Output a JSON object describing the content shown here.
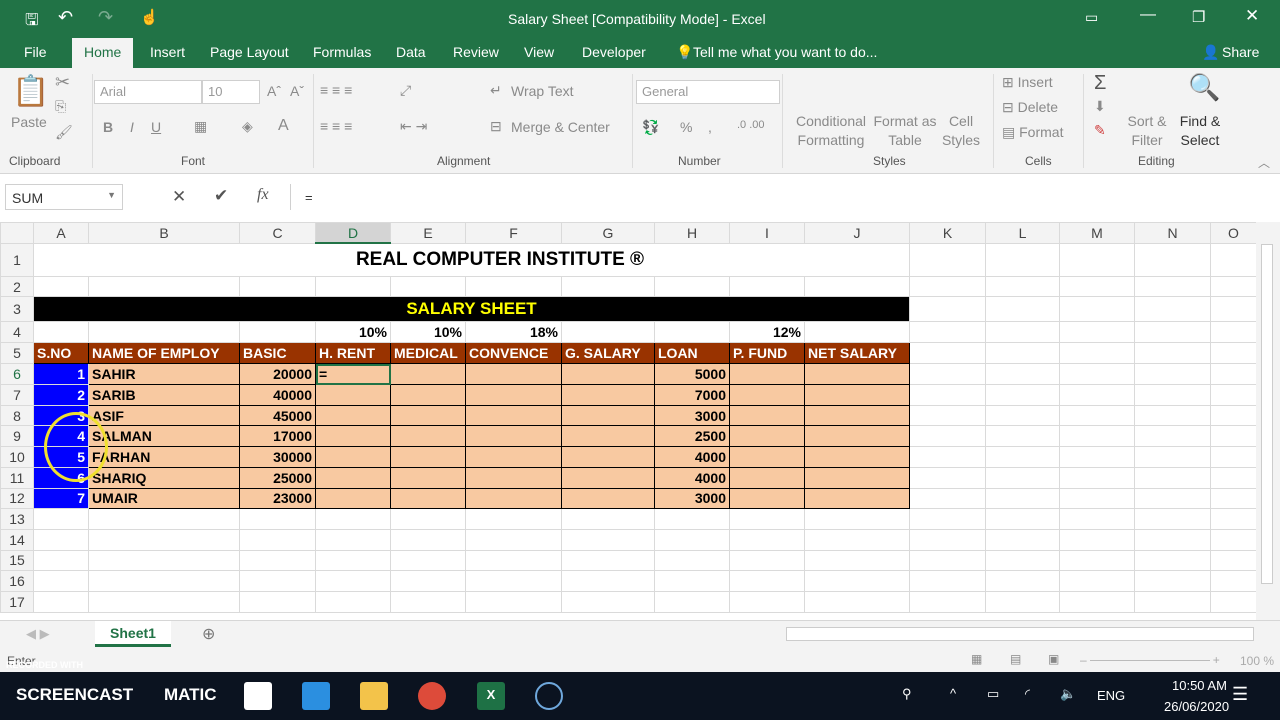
{
  "title": "Salary Sheet  [Compatibility Mode] - Excel",
  "tabs": [
    "File",
    "Home",
    "Insert",
    "Page Layout",
    "Formulas",
    "Data",
    "Review",
    "View",
    "Developer"
  ],
  "tell_me": "Tell me what you want to do...",
  "share": "Share",
  "ribbon": {
    "paste": "Paste",
    "font_name": "Arial",
    "font_size": "10",
    "wrap_text": "Wrap Text",
    "merge_center": "Merge & Center",
    "number_format": "General",
    "conditional": "Conditional Formatting",
    "format_table": "Format as Table",
    "cell_styles": "Cell Styles",
    "insert": "Insert",
    "delete": "Delete",
    "format": "Format",
    "sort": "Sort & Filter",
    "find": "Find & Select",
    "groups": [
      "Clipboard",
      "Font",
      "Alignment",
      "Number",
      "Styles",
      "Cells",
      "Editing"
    ]
  },
  "formula_bar": {
    "name_box": "SUM",
    "formula": "="
  },
  "columns": [
    "A",
    "B",
    "C",
    "D",
    "E",
    "F",
    "G",
    "H",
    "I",
    "J",
    "K",
    "L",
    "M",
    "N",
    "O"
  ],
  "sheet": {
    "title": "REAL COMPUTER INSTITUTE ®",
    "banner": "SALARY SHEET",
    "rates": {
      "D": "10%",
      "E": "10%",
      "F": "18%",
      "I": "12%"
    },
    "headers": [
      "S.NO",
      "NAME OF EMPLOY",
      "BASIC",
      "H. RENT",
      "MEDICAL",
      "CONVENCE",
      "G. SALARY",
      "LOAN",
      "P. FUND",
      "NET SALARY"
    ],
    "rows": [
      {
        "sno": "1",
        "name": "SAHIR",
        "basic": "20000",
        "hrent": "=",
        "loan": "5000"
      },
      {
        "sno": "2",
        "name": "SARIB",
        "basic": "40000",
        "hrent": "",
        "loan": "7000"
      },
      {
        "sno": "3",
        "name": "ASIF",
        "basic": "45000",
        "hrent": "",
        "loan": "3000"
      },
      {
        "sno": "4",
        "name": "SALMAN",
        "basic": "17000",
        "hrent": "",
        "loan": "2500"
      },
      {
        "sno": "5",
        "name": "FARHAN",
        "basic": "30000",
        "hrent": "",
        "loan": "4000"
      },
      {
        "sno": "6",
        "name": "SHARIQ",
        "basic": "25000",
        "hrent": "",
        "loan": "4000"
      },
      {
        "sno": "7",
        "name": "UMAIR",
        "basic": "23000",
        "hrent": "",
        "loan": "3000"
      }
    ]
  },
  "sheet_tab": "Sheet1",
  "status": {
    "mode": "Enter",
    "zoom": "100 %"
  },
  "taskbar": {
    "watermark_top": "RECORDED WITH",
    "watermark": "SCREENCAST",
    "watermark2": "MATIC",
    "lang": "ENG",
    "time": "10:50 AM",
    "date": "26/06/2020"
  }
}
